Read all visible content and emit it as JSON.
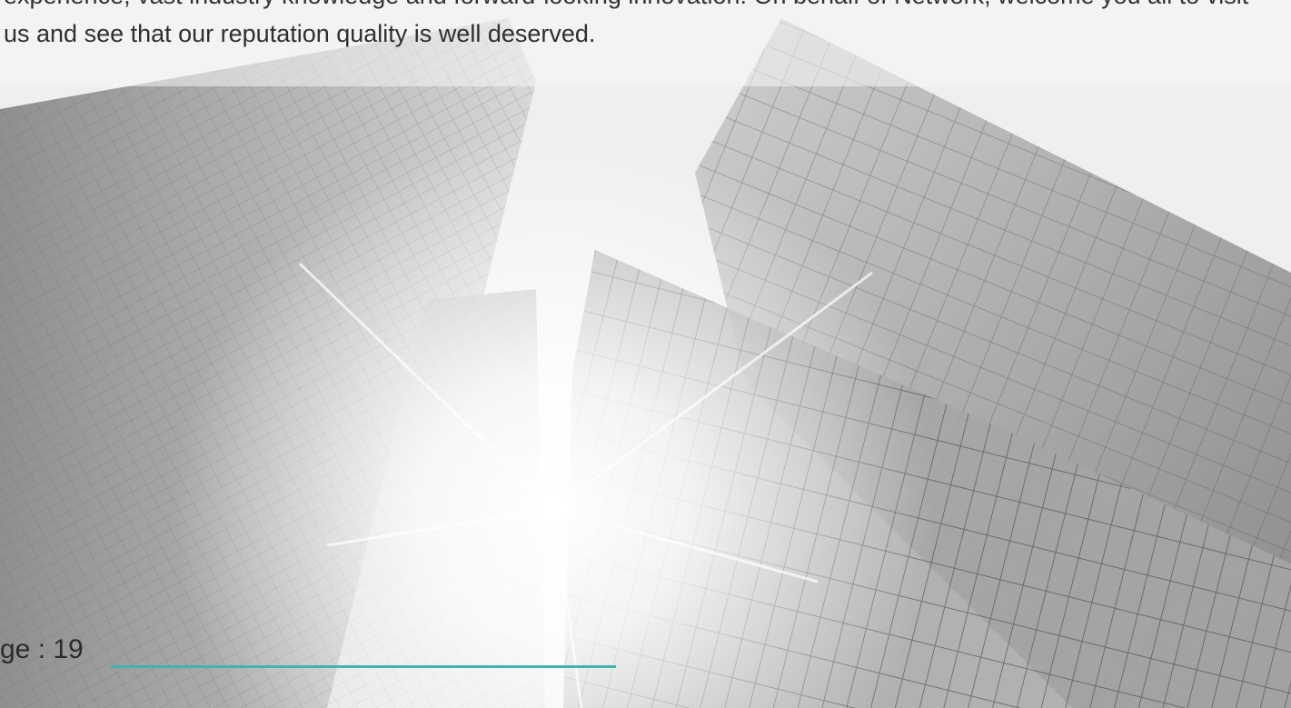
{
  "intro": {
    "line1": "experience, vast industry knowledge and forward-looking innovation. On behalf of Network, welcome you all to visit",
    "line2": "us and see that our reputation quality is well deserved."
  },
  "footer": {
    "page_text": "ge : 19"
  },
  "colors": {
    "accent_rule": "#3fb5ad",
    "text": "#2f2f2f"
  },
  "image": {
    "subject": "skyscrapers-looking-up-with-sunburst"
  }
}
